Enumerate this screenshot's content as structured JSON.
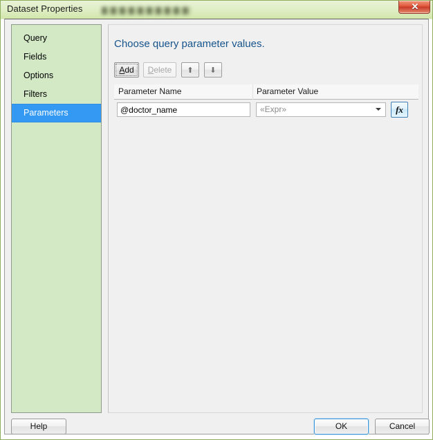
{
  "window": {
    "title": "Dataset Properties",
    "close_label": "✕",
    "close_icon": "close-icon",
    "redacted_region": true
  },
  "sidebar": {
    "items": [
      {
        "label": "Query",
        "selected": false
      },
      {
        "label": "Fields",
        "selected": false
      },
      {
        "label": "Options",
        "selected": false
      },
      {
        "label": "Filters",
        "selected": false
      },
      {
        "label": "Parameters",
        "selected": true
      }
    ]
  },
  "main": {
    "heading": "Choose query parameter values.",
    "toolbar": {
      "add_label": "Add",
      "add_accesskey": "A",
      "delete_label": "Delete",
      "delete_accesskey": "D",
      "delete_enabled": false,
      "move_up_icon": "arrow-up-icon",
      "move_up_glyph": "⬆",
      "move_down_icon": "arrow-down-icon",
      "move_down_glyph": "⬇"
    },
    "grid": {
      "columns": [
        "Parameter Name",
        "Parameter Value"
      ],
      "rows": [
        {
          "parameter_name": "@doctor_name",
          "parameter_value": "",
          "parameter_value_placeholder": "«Expr»",
          "expression_button_label": "fx"
        }
      ]
    }
  },
  "footer": {
    "help_label": "Help",
    "ok_label": "OK",
    "cancel_label": "Cancel"
  },
  "colors": {
    "window_frame": "#cfe4a8",
    "selection_blue": "#3399f3",
    "heading_blue": "#16548c",
    "sidebar_green": "#d3e9c6",
    "close_red": "#c9392a",
    "fx_button_blue": "#3f7fb5"
  }
}
